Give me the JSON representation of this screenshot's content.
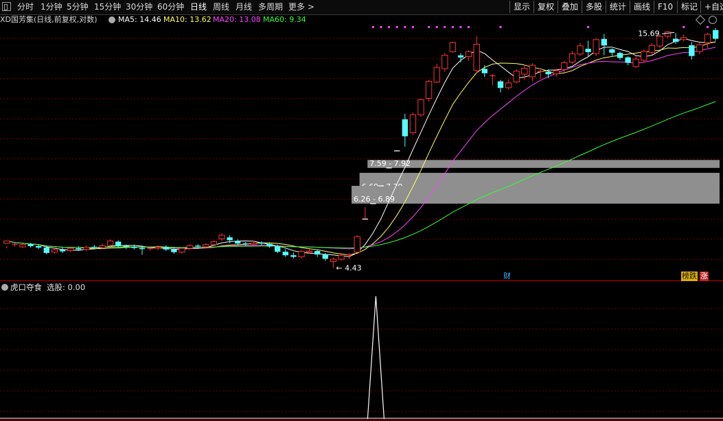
{
  "toolbar": {
    "periods": [
      "分时",
      "1分钟",
      "5分钟",
      "15分钟",
      "30分钟",
      "60分钟",
      "日线",
      "周线",
      "月线",
      "多周期",
      "更多 >"
    ],
    "active_period": "日线",
    "right_buttons": [
      "显示",
      "复权",
      "叠加",
      "多股",
      "统计",
      "画线",
      "F10",
      "标记",
      "+自选"
    ]
  },
  "legend": {
    "title": "XD国芳集(日线,前复权,对数)",
    "ma5": "MA5: 14.46",
    "ma10": "MA10: 13.62",
    "ma20": "MA20: 13.08",
    "ma60": "MA60: 9.34"
  },
  "colors": {
    "up": "#ff3232",
    "down": "#54ffff",
    "ma5": "#ffffff",
    "ma10": "#ffff66",
    "ma20": "#ff44ff",
    "ma60": "#33ff33",
    "gap_band": "#8f8f8f",
    "grid": "#7a0000",
    "divider": "#c00000"
  },
  "annotations": {
    "high_label": "15.69",
    "low_label": "4.43",
    "gap_labels": [
      "7.59 - 7.92",
      "6.69 - 7.39",
      "6.26 - 6.89"
    ],
    "fin_badge": "财",
    "rank_badge": "榜跌",
    "up_badge": "涨"
  },
  "indicator": {
    "name": "虎口夺食",
    "value_label": "选股: 0.00"
  },
  "chart_data": {
    "type": "candlestick",
    "title": "XD国芳集(日线,前复权,对数)",
    "y_scale": "log",
    "ylim": [
      4.2,
      16.3
    ],
    "candles": [
      [
        5.05,
        5.12,
        4.98,
        4.92
      ],
      [
        5.02,
        5.03,
        5.1,
        4.96
      ],
      [
        4.96,
        5.02,
        5.08,
        4.93
      ],
      [
        5.03,
        4.98,
        5.06,
        4.94
      ],
      [
        4.98,
        4.94,
        5.03,
        4.9
      ],
      [
        4.94,
        4.8,
        4.99,
        4.76
      ],
      [
        4.82,
        4.88,
        4.93,
        4.78
      ],
      [
        4.88,
        4.84,
        4.95,
        4.8
      ],
      [
        4.86,
        4.92,
        4.97,
        4.82
      ],
      [
        4.92,
        4.89,
        4.98,
        4.85
      ],
      [
        4.89,
        4.95,
        5.0,
        4.85
      ],
      [
        4.95,
        4.93,
        5.01,
        4.89
      ],
      [
        4.94,
        4.99,
        5.04,
        4.9
      ],
      [
        5.0,
        5.12,
        5.16,
        4.96
      ],
      [
        5.1,
        4.98,
        5.14,
        4.94
      ],
      [
        4.98,
        4.96,
        5.02,
        4.9
      ],
      [
        4.96,
        4.93,
        5.02,
        4.89
      ],
      [
        4.93,
        4.9,
        4.99,
        4.75
      ],
      [
        4.9,
        4.92,
        4.98,
        4.86
      ],
      [
        4.92,
        4.95,
        5.0,
        4.87
      ],
      [
        4.95,
        4.89,
        5.0,
        4.85
      ],
      [
        4.89,
        4.82,
        4.95,
        4.78
      ],
      [
        4.82,
        4.92,
        4.95,
        4.78
      ],
      [
        4.92,
        4.99,
        5.03,
        4.88
      ],
      [
        4.98,
        4.96,
        5.03,
        4.91
      ],
      [
        4.96,
        5.02,
        5.06,
        4.92
      ],
      [
        5.02,
        5.1,
        5.13,
        4.98
      ],
      [
        5.18,
        5.28,
        5.33,
        5.12
      ],
      [
        5.22,
        5.14,
        5.28,
        5.06
      ],
      [
        5.12,
        5.05,
        5.16,
        5.0
      ],
      [
        5.04,
        5.03,
        5.09,
        4.98
      ],
      [
        5.03,
        5.06,
        5.12,
        4.99
      ],
      [
        5.06,
        5.04,
        5.11,
        5.0
      ],
      [
        5.04,
        4.97,
        5.08,
        4.93
      ],
      [
        4.97,
        4.83,
        5.02,
        4.79
      ],
      [
        4.83,
        4.74,
        4.9,
        4.7
      ],
      [
        4.74,
        4.7,
        4.81,
        4.66
      ],
      [
        4.7,
        4.84,
        4.88,
        4.66
      ],
      [
        4.82,
        4.85,
        4.9,
        4.78
      ],
      [
        4.85,
        4.76,
        4.89,
        4.7
      ],
      [
        4.76,
        4.65,
        4.8,
        4.6
      ],
      [
        4.58,
        4.64,
        4.68,
        4.43
      ],
      [
        4.64,
        4.73,
        4.79,
        4.6
      ],
      [
        4.73,
        4.75,
        4.8,
        4.64
      ],
      [
        4.82,
        5.24,
        5.28,
        4.8
      ],
      [
        5.76,
        5.76,
        6.14,
        5.76
      ],
      [
        6.26,
        6.26,
        6.26,
        6.26
      ],
      [
        6.89,
        6.89,
        6.89,
        6.89
      ],
      [
        7.59,
        7.59,
        7.59,
        7.59
      ],
      [
        8.32,
        8.32,
        8.32,
        8.32
      ],
      [
        9.86,
        9.0,
        10.16,
        8.51
      ],
      [
        9.17,
        10.11,
        10.23,
        9.06
      ],
      [
        10.1,
        10.96,
        11.02,
        10.0
      ],
      [
        11.04,
        12.1,
        12.2,
        10.84
      ],
      [
        12.05,
        13.05,
        13.3,
        11.96
      ],
      [
        12.95,
        13.93,
        14.09,
        12.73
      ],
      [
        14.2,
        14.91,
        15.0,
        14.1
      ],
      [
        13.92,
        13.76,
        14.08,
        13.4
      ],
      [
        13.83,
        14.19,
        14.32,
        13.5
      ],
      [
        12.83,
        14.78,
        15.45,
        12.63
      ],
      [
        12.94,
        12.64,
        13.2,
        12.4
      ],
      [
        12.47,
        12.47,
        12.59,
        11.85
      ],
      [
        12.1,
        11.68,
        12.2,
        11.4
      ],
      [
        11.69,
        12.0,
        12.23,
        11.58
      ],
      [
        12.06,
        12.78,
        12.91,
        11.98
      ],
      [
        12.58,
        12.98,
        13.25,
        12.2
      ],
      [
        12.4,
        13.2,
        13.35,
        12.11
      ],
      [
        12.76,
        12.76,
        12.98,
        12.25
      ],
      [
        12.74,
        12.57,
        12.9,
        12.3
      ],
      [
        12.6,
        12.82,
        12.95,
        12.4
      ],
      [
        12.9,
        13.38,
        13.52,
        12.7
      ],
      [
        13.42,
        14.04,
        14.25,
        13.26
      ],
      [
        14.02,
        14.65,
        14.89,
        13.88
      ],
      [
        14.42,
        14.17,
        15.06,
        13.86
      ],
      [
        14.05,
        15.15,
        15.27,
        13.86
      ],
      [
        15.21,
        14.68,
        15.62,
        13.93
      ],
      [
        14.38,
        14.12,
        14.48,
        13.88
      ],
      [
        14.1,
        13.73,
        14.2,
        13.58
      ],
      [
        13.77,
        13.37,
        13.85,
        13.2
      ],
      [
        13.1,
        13.64,
        13.86,
        13.02
      ],
      [
        13.56,
        14.22,
        14.38,
        13.42
      ],
      [
        14.15,
        14.68,
        14.85,
        14.0
      ],
      [
        14.64,
        15.42,
        15.59,
        14.48
      ],
      [
        15.43,
        15.8,
        15.88,
        15.26
      ],
      [
        15.22,
        14.97,
        15.69,
        14.8
      ],
      [
        15.15,
        15.32,
        15.6,
        15.0
      ],
      [
        14.7,
        13.87,
        14.96,
        13.61
      ],
      [
        14.2,
        14.75,
        14.89,
        13.98
      ],
      [
        14.9,
        15.59,
        15.73,
        14.48
      ],
      [
        15.95,
        15.22,
        16.14,
        15.06
      ]
    ],
    "ma_series": [
      {
        "name": "MA5",
        "value": 14.46
      },
      {
        "name": "MA10",
        "value": 13.62
      },
      {
        "name": "MA20",
        "value": 13.08
      },
      {
        "name": "MA60",
        "value": 9.34
      }
    ],
    "gap_zones": [
      {
        "low": 7.59,
        "high": 7.92
      },
      {
        "low": 6.69,
        "high": 7.39
      },
      {
        "low": 6.26,
        "high": 6.89
      }
    ],
    "max_label": 15.69,
    "min_label": 4.43,
    "indicator": {
      "name": "虎口夺食",
      "signal_bars": [
        46
      ],
      "signal_value": 1,
      "value": 0.0
    }
  }
}
